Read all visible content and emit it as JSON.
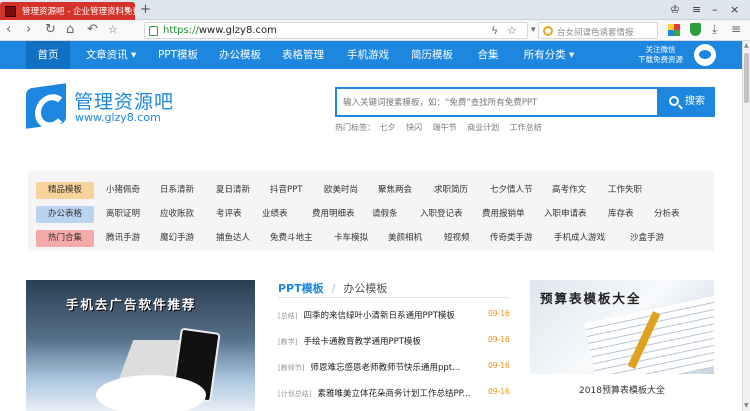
{
  "browser": {
    "tab_title": "管理资源吧 - 企业管理资料免费",
    "url_scheme": "https://",
    "url_host": "www.glzy8.com",
    "search_placeholder": "台女间谍色诱套情报",
    "new_tab": "+",
    "tab_close": "×",
    "nav_back": "‹",
    "nav_forward": "›",
    "nav_reload": "↻",
    "nav_undo": "↶",
    "nav_home": "⌂"
  },
  "site_nav": {
    "items": [
      "首页",
      "文章资讯",
      "PPT模板",
      "办公模板",
      "表格管理",
      "手机游戏",
      "简历模板",
      "合集",
      "所有分类"
    ],
    "follow_line1": "关注微信",
    "follow_line2": "下载免费资源"
  },
  "header": {
    "logo_title": "管理资源吧",
    "logo_url": "www.glzy8.com",
    "search_placeholder": "输入关键词搜素模板，如：“免费”查找所有免费PPT",
    "search_button": "搜索",
    "hot_label": "热门标签：",
    "hot_tags": [
      "七夕",
      "快闪",
      "端午节",
      "商业计划",
      "工作总结"
    ]
  },
  "categories": [
    {
      "label": "精品模板",
      "color": "#f8d29b",
      "items": [
        "小猪佩奇",
        "日系清新",
        "夏日清新",
        "抖音PPT",
        "欧美时尚",
        "聚焦两会",
        "求职简历",
        "七夕情人节",
        "高考作文",
        "工作失职"
      ]
    },
    {
      "label": "办公表格",
      "color": "#b9d3f0",
      "items": [
        "离职证明",
        "应收账款",
        "考评表",
        "业绩表",
        "费用明细表",
        "请假条",
        "入职登记表",
        "费用报销单",
        "入职申请表",
        "库存表",
        "分析表"
      ]
    },
    {
      "label": "热门合集",
      "color": "#f4aaa9",
      "items": [
        "腾讯手游",
        "魔幻手游",
        "捕鱼达人",
        "免费斗地主",
        "卡车模拟",
        "美颜相机",
        "短视频",
        "传奇类手游",
        "手机成人游戏",
        "沙盒手游"
      ]
    }
  ],
  "hero": {
    "title": "手机去广告软件推荐"
  },
  "content_tabs": {
    "active": "PPT模板",
    "separator": "/",
    "inactive": "办公模板"
  },
  "articles": [
    {
      "tag": "[总结]",
      "title": "四季的来信绿叶小清新日系通用PPT模板",
      "date": "09-16"
    },
    {
      "tag": "[教学]",
      "title": "手绘卡通教育教学通用PPT模板",
      "date": "09-16"
    },
    {
      "tag": "[教师节]",
      "title": "师恩难忘感恩老师教师节快乐通用ppt...",
      "date": "09-16"
    },
    {
      "tag": "[计划总结]",
      "title": "素雅唯美立体花朵商务计划工作总结PP...",
      "date": "09-16"
    }
  ],
  "side_card": {
    "image_title": "预算表模板大全",
    "caption": "2018预算表模板大全"
  }
}
